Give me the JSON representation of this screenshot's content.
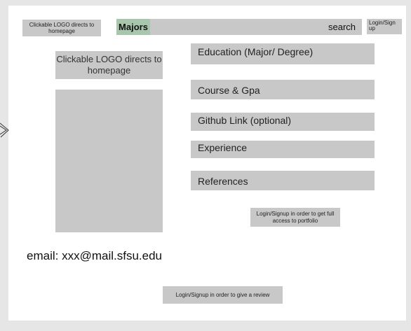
{
  "header": {
    "logo_text": "Clickable LOGO directs to homepage",
    "majors_label": "Majors",
    "search_label": "search",
    "login_label": "Login/Sign up"
  },
  "profile": {
    "logo_text": "Clickable LOGO directs to homepage",
    "email": "email: xxx@mail.sfsu.edu"
  },
  "fields": [
    "Education (Major/ Degree)",
    "Course & Gpa",
    "Github Link (optional)",
    "Experience",
    "References"
  ],
  "notes": {
    "portfolio_access": "Login/Signup in order to get full access to portfolio",
    "review": "Login/Signup  in order to give a review"
  },
  "colors": {
    "placeholder_gray": "#c8c8c8",
    "majors_green": "#a8c6ab",
    "background": "#e6e6e6"
  }
}
